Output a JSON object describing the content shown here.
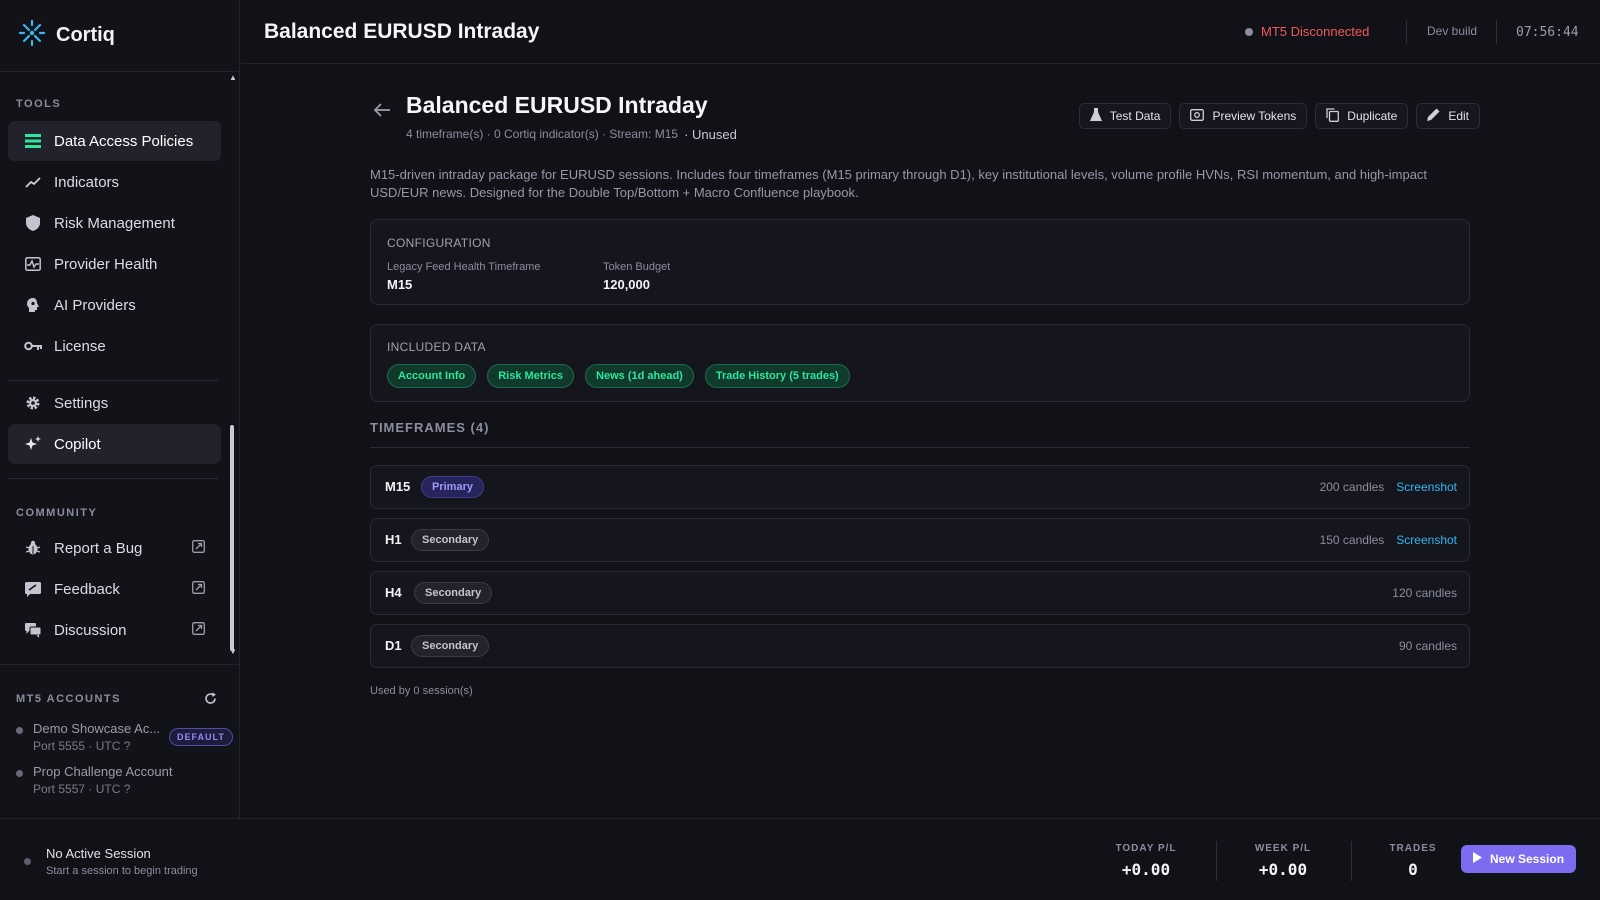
{
  "app": {
    "name": "Cortiq"
  },
  "topbar": {
    "title": "Balanced EURUSD Intraday",
    "mt5_status": "MT5 Disconnected",
    "build": "Dev build",
    "clock": "07:56:44"
  },
  "sidebar": {
    "tools_title": "TOOLS",
    "items": [
      {
        "label": "Data Access Policies"
      },
      {
        "label": "Indicators"
      },
      {
        "label": "Risk Management"
      },
      {
        "label": "Provider Health"
      },
      {
        "label": "AI Providers"
      },
      {
        "label": "License"
      },
      {
        "label": "Settings"
      },
      {
        "label": "Copilot"
      }
    ],
    "community_title": "COMMUNITY",
    "community": [
      {
        "label": "Report a Bug"
      },
      {
        "label": "Feedback"
      },
      {
        "label": "Discussion"
      }
    ],
    "accounts_title": "MT5 ACCOUNTS",
    "accounts": [
      {
        "name": "Demo Showcase Ac...",
        "sub": "Port 5555 · UTC ?",
        "badge": "DEFAULT"
      },
      {
        "name": "Prop Challenge Account",
        "sub": "Port 5557 · UTC ?"
      }
    ]
  },
  "policy": {
    "title": "Balanced EURUSD Intraday",
    "meta": "4 timeframe(s) · 0 Cortiq indicator(s) · Stream: M15",
    "status": "· Unused",
    "actions": {
      "test_data": "Test Data",
      "preview_tokens": "Preview Tokens",
      "duplicate": "Duplicate",
      "edit": "Edit"
    },
    "description": "M15-driven intraday package for EURUSD sessions. Includes four timeframes (M15 primary through D1), key institutional levels, volume profile HVNs, RSI momentum, and high-impact USD/EUR news. Designed for the Double Top/Bottom + Macro Confluence playbook.",
    "configuration": {
      "title": "CONFIGURATION",
      "legacy_label": "Legacy Feed Health Timeframe",
      "legacy_value": "M15",
      "budget_label": "Token Budget",
      "budget_value": "120,000"
    },
    "included": {
      "title": "INCLUDED DATA",
      "chips": [
        "Account Info",
        "Risk Metrics",
        "News (1d ahead)",
        "Trade History (5 trades)"
      ]
    },
    "timeframes_title": "TIMEFRAMES (4)",
    "timeframes": [
      {
        "name": "M15",
        "role": "Primary",
        "candles": "200 candles",
        "screenshot": "Screenshot"
      },
      {
        "name": "H1",
        "role": "Secondary",
        "candles": "150 candles",
        "screenshot": "Screenshot"
      },
      {
        "name": "H4",
        "role": "Secondary",
        "candles": "120 candles"
      },
      {
        "name": "D1",
        "role": "Secondary",
        "candles": "90 candles"
      }
    ],
    "used_by": "Used by 0 session(s)"
  },
  "bottom": {
    "session_title": "No Active Session",
    "session_sub": "Start a session to begin trading",
    "today_label": "TODAY P/L",
    "today_value": "+0.00",
    "week_label": "WEEK P/L",
    "week_value": "+0.00",
    "trades_label": "TRADES",
    "trades_value": "0",
    "new_session": "New Session"
  },
  "colors": {
    "accent": "#7c6cf0",
    "success": "#2ee59d",
    "danger": "#f05a5a",
    "link": "#33b6f2"
  }
}
